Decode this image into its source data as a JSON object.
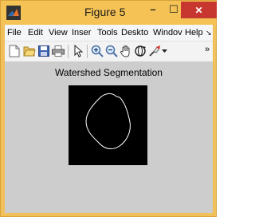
{
  "window": {
    "title": "Figure 5",
    "controls": {
      "minimize_glyph": "–",
      "maximize_glyph": "☐",
      "close_glyph": "✕"
    }
  },
  "menubar": {
    "items": [
      {
        "label": "File"
      },
      {
        "label": "Edit"
      },
      {
        "label": "View"
      },
      {
        "label": "Inser"
      },
      {
        "label": "Tools"
      },
      {
        "label": "Deskto"
      },
      {
        "label": "Windov"
      },
      {
        "label": "Help"
      }
    ],
    "overflow_glyph": "↘"
  },
  "toolbar": {
    "icons": [
      "new-figure-icon",
      "open-file-icon",
      "save-icon",
      "print-icon",
      "pointer-icon",
      "zoom-in-icon",
      "zoom-out-icon",
      "pan-icon",
      "rotate-3d-icon",
      "data-cursor-icon",
      "dropdown-arrow-icon"
    ],
    "overflow_glyph": "»"
  },
  "figure": {
    "title": "Watershed Segmentation",
    "image_background": "#000000",
    "contour_color": "#ffffff"
  },
  "colors": {
    "titlebar": "#f5c255",
    "close_button": "#c7372f",
    "figure_background": "#cdcdcd"
  }
}
